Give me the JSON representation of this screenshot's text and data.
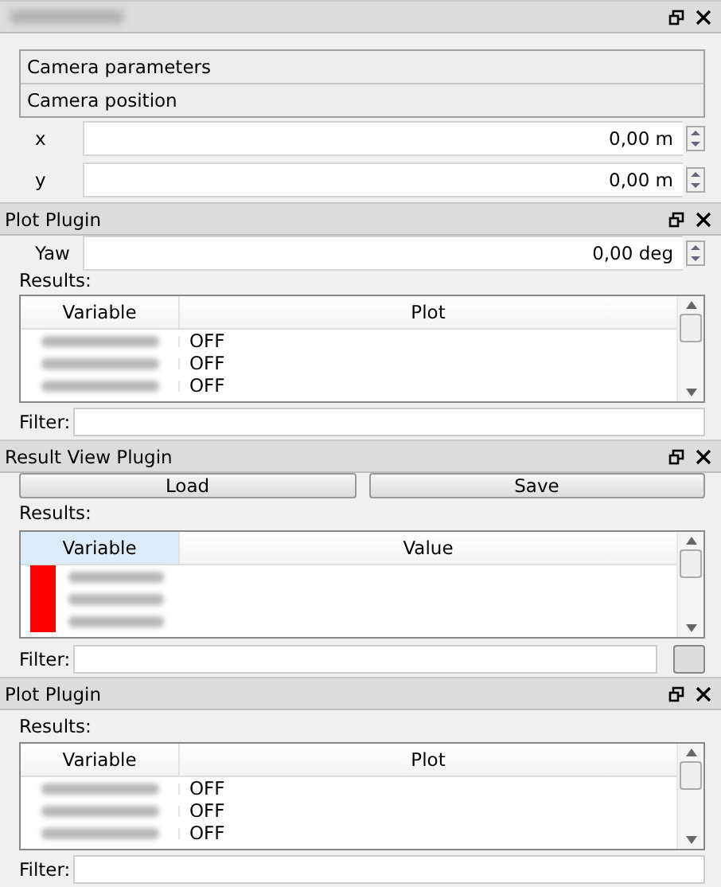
{
  "camera_panel": {
    "sections": [
      {
        "label": "Camera parameters"
      },
      {
        "label": "Camera position"
      }
    ],
    "fields": [
      {
        "label": "x",
        "value": "0,00 m"
      },
      {
        "label": "y",
        "value": "0,00 m"
      }
    ]
  },
  "plot_panel": {
    "title": "Plot Plugin",
    "field": {
      "label": "Yaw",
      "value": "0,00 deg"
    },
    "results_label": "Results:",
    "columns": [
      "Variable",
      "Plot"
    ],
    "rows": [
      {
        "plot": "OFF"
      },
      {
        "plot": "OFF"
      },
      {
        "plot": "OFF"
      }
    ],
    "filter_label": "Filter:"
  },
  "result_view_panel": {
    "title": "Result View Plugin",
    "buttons": [
      "Load",
      "Save"
    ],
    "results_label": "Results:",
    "columns": [
      {
        "label": "Variable",
        "selected": true
      },
      {
        "label": "Value",
        "selected": false
      }
    ],
    "rows": [
      {
        "color": "#ff0000"
      },
      {
        "color": "#ff0000"
      },
      {
        "color": "#ff0000"
      }
    ],
    "filter_label": "Filter:"
  },
  "plot_panel_2": {
    "title": "Plot Plugin",
    "results_label": "Results:",
    "columns": [
      "Variable",
      "Plot"
    ],
    "rows": [
      {
        "plot": "OFF"
      },
      {
        "plot": "OFF"
      },
      {
        "plot": "OFF"
      }
    ],
    "filter_label": "Filter:"
  }
}
